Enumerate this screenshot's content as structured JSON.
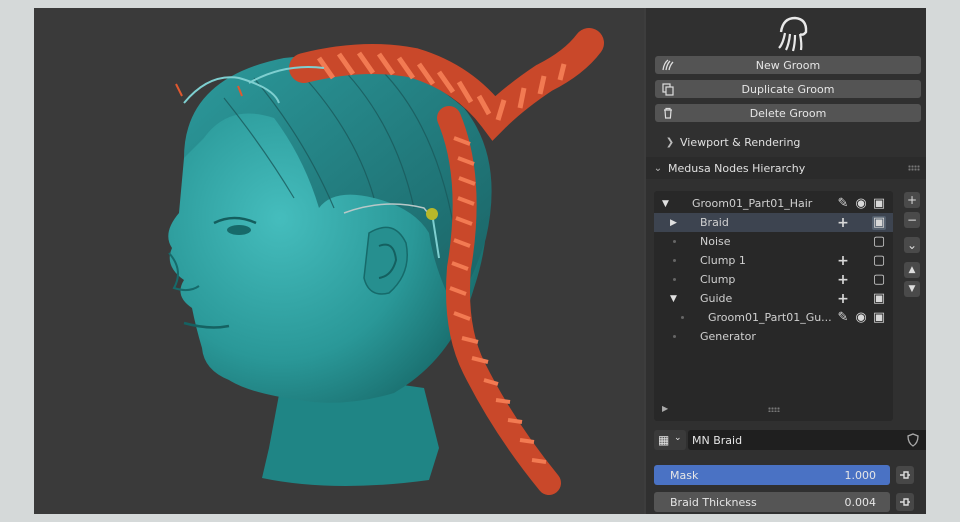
{
  "panel": {
    "buttons": {
      "new_groom": "New Groom",
      "duplicate_groom": "Duplicate Groom",
      "delete_groom": "Delete Groom"
    },
    "sections": {
      "viewport_rendering": "Viewport & Rendering",
      "hierarchy": "Medusa Nodes Hierarchy"
    },
    "tree": {
      "items": [
        {
          "label": "Groom01_Part01_Hair"
        },
        {
          "label": "Braid"
        },
        {
          "label": "Noise"
        },
        {
          "label": "Clump 1"
        },
        {
          "label": "Clump"
        },
        {
          "label": "Guide"
        },
        {
          "label": "Groom01_Part01_Gu..."
        },
        {
          "label": "Generator"
        }
      ]
    },
    "node_name": "MN Braid",
    "properties": {
      "mask_label": "Mask",
      "mask_value": "1.000",
      "thickness_label": "Braid Thickness",
      "thickness_value": "0.004"
    }
  },
  "colors": {
    "accent": "#4a72c4",
    "skin": "#2fa3a3",
    "braid": "#e0582f",
    "panel_bg": "#303030"
  }
}
